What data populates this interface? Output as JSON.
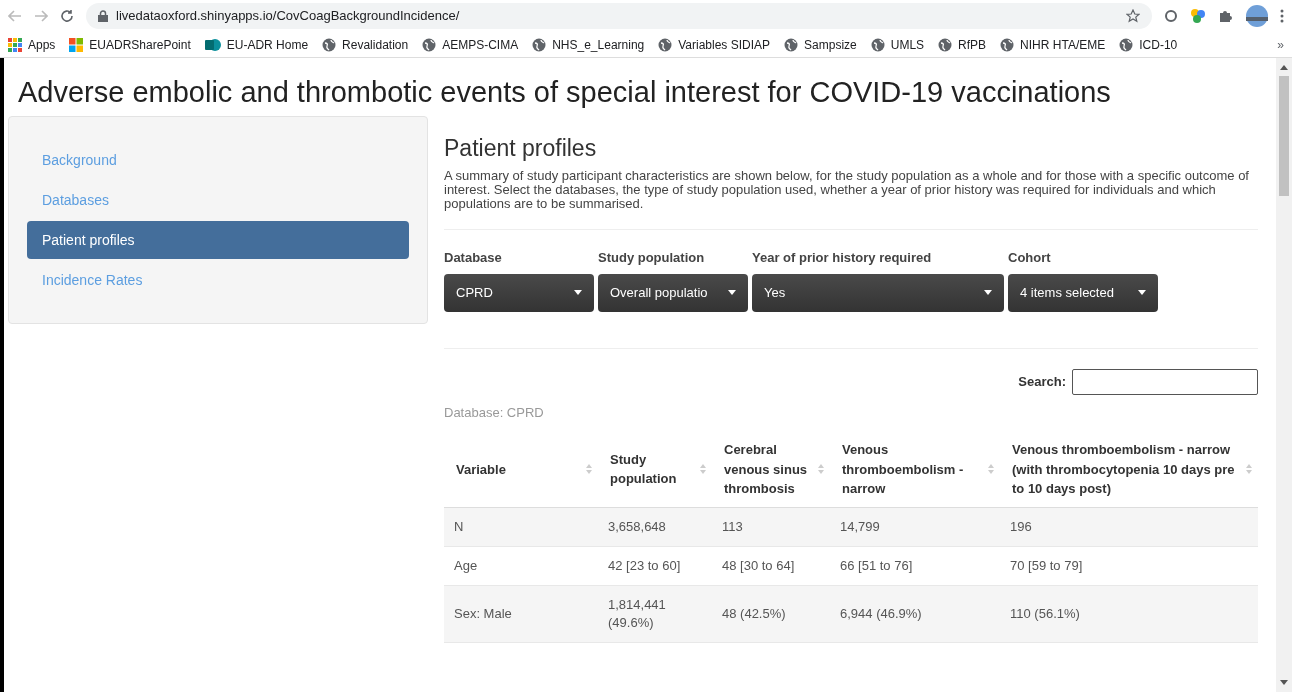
{
  "browser": {
    "url": "livedataoxford.shinyapps.io/CovCoagBackgroundIncidence/",
    "bookmarks": [
      {
        "label": "Apps",
        "kind": "apps"
      },
      {
        "label": "EUADRSharePoint",
        "kind": "ms"
      },
      {
        "label": "EU-ADR Home",
        "kind": "sp"
      },
      {
        "label": "Revalidation",
        "kind": "globe"
      },
      {
        "label": "AEMPS-CIMA",
        "kind": "globe"
      },
      {
        "label": "NHS_e_Learning",
        "kind": "globe"
      },
      {
        "label": "Variables SIDIAP",
        "kind": "globe"
      },
      {
        "label": "Sampsize",
        "kind": "globe"
      },
      {
        "label": "UMLS",
        "kind": "globe"
      },
      {
        "label": "RfPB",
        "kind": "globe"
      },
      {
        "label": "NIHR HTA/EME",
        "kind": "globe"
      },
      {
        "label": "ICD-10",
        "kind": "globe"
      }
    ],
    "more": "»"
  },
  "page": {
    "title": "Adverse embolic and thrombotic events of special interest for COVID-19 vaccinations",
    "sidebar": {
      "items": [
        {
          "label": "Background",
          "selected": false
        },
        {
          "label": "Databases",
          "selected": false
        },
        {
          "label": "Patient profiles",
          "selected": true
        },
        {
          "label": "Incidence Rates",
          "selected": false
        }
      ]
    },
    "main": {
      "heading": "Patient profiles",
      "description": "A summary of study participant characteristics are shown below, for the study population as a whole and for those with a specific outcome of interest. Select the databases, the type of study population used, whether a year of prior history was required for individuals and which populations are to be summarised.",
      "filters": [
        {
          "label": "Database",
          "value": "CPRD"
        },
        {
          "label": "Study population",
          "value": "Overall populatio"
        },
        {
          "label": "Year of prior history required",
          "value": "Yes"
        },
        {
          "label": "Cohort",
          "value": "4 items selected"
        }
      ],
      "search": {
        "label": "Search:"
      },
      "caption": "Database: CPRD",
      "table": {
        "columns": [
          "Variable",
          "Study population",
          "Cerebral venous sinus thrombosis",
          "Venous thromboembolism - narrow",
          "Venous thromboembolism - narrow (with thrombocytopenia 10 days pre to 10 days post)"
        ],
        "rows": [
          [
            "N",
            "3,658,648",
            "113",
            "14,799",
            "196"
          ],
          [
            "Age",
            "42 [23 to 60]",
            "48 [30 to 64]",
            "66 [51 to 76]",
            "70 [59 to 79]"
          ],
          [
            "Sex: Male",
            "1,814,441 (49.6%)",
            "48 (42.5%)",
            "6,944 (46.9%)",
            "110 (56.1%)"
          ]
        ]
      }
    }
  }
}
